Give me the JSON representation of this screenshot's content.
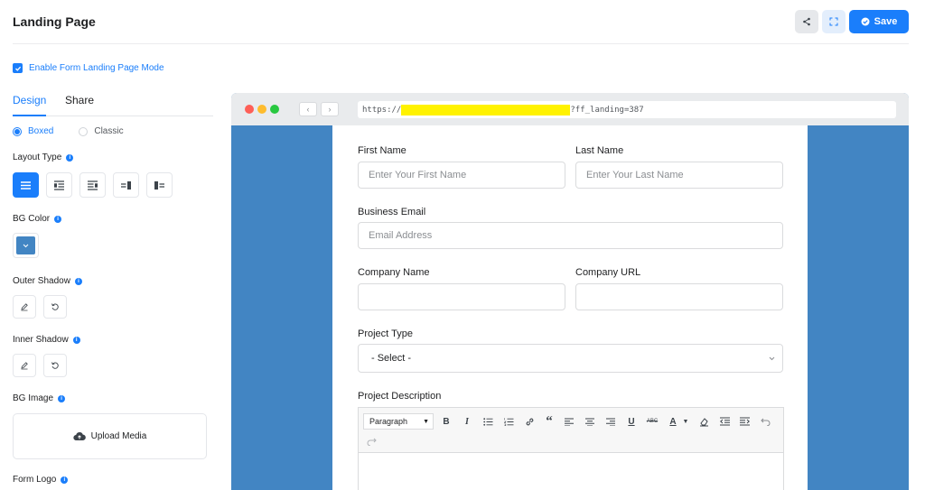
{
  "header": {
    "title": "Landing Page",
    "save_label": "Save"
  },
  "mode_checkbox": {
    "label": "Enable Form Landing Page Mode",
    "checked": true
  },
  "tabs": [
    {
      "label": "Design",
      "active": true
    },
    {
      "label": "Share",
      "active": false
    }
  ],
  "style_options": [
    {
      "label": "Boxed",
      "selected": true
    },
    {
      "label": "Classic",
      "selected": false
    }
  ],
  "sections": {
    "layout_type": "Layout Type",
    "bg_color": "BG Color",
    "outer_shadow": "Outer Shadow",
    "inner_shadow": "Inner Shadow",
    "bg_image": "BG Image",
    "form_logo": "Form Logo"
  },
  "bg_color_value": "#4285c3",
  "accent_color": "#1a7efb",
  "upload_label": "Upload Media",
  "preview": {
    "url_prefix": "https://",
    "url_suffix": "?ff_landing=387",
    "form": {
      "first_name": {
        "label": "First Name",
        "placeholder": "Enter Your First Name"
      },
      "last_name": {
        "label": "Last Name",
        "placeholder": "Enter Your Last Name"
      },
      "business_email": {
        "label": "Business Email",
        "placeholder": "Email Address"
      },
      "company_name": {
        "label": "Company Name",
        "placeholder": ""
      },
      "company_url": {
        "label": "Company URL",
        "placeholder": ""
      },
      "project_type": {
        "label": "Project Type",
        "selected": "- Select -"
      },
      "project_description": {
        "label": "Project Description",
        "format": "Paragraph"
      }
    }
  }
}
